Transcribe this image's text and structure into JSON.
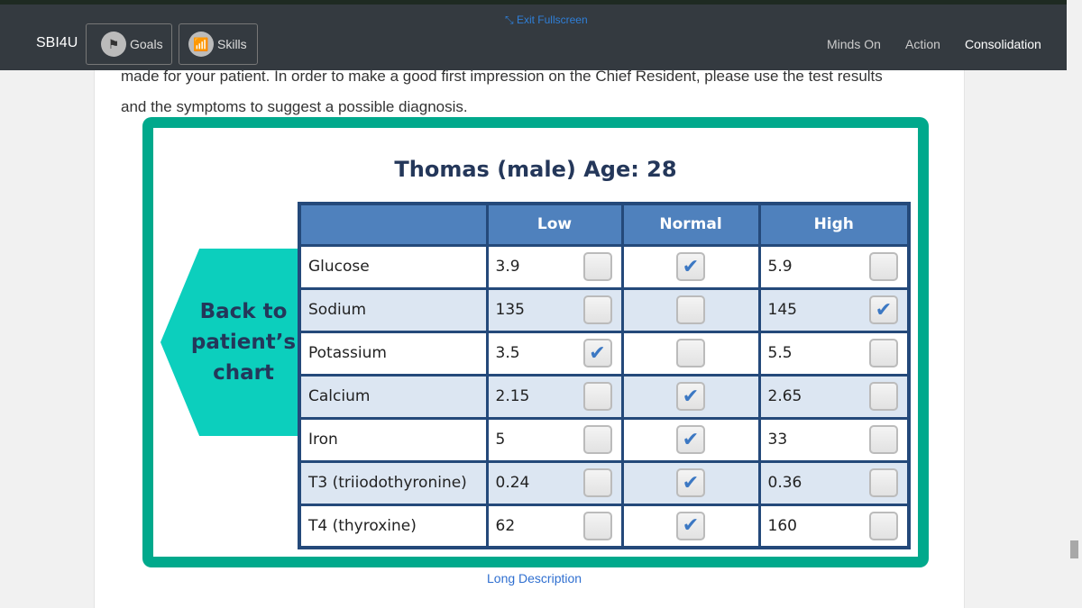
{
  "topbar": {
    "brand": "SBI4U",
    "goals": "Goals",
    "skills": "Skills",
    "exit_fullscreen": "Exit Fullscreen",
    "right_nav": [
      "Minds On",
      "Action",
      "Consolidation"
    ]
  },
  "intro": {
    "line1": "made for your patient. In order to make a good first impression on the Chief Resident, please use the test results",
    "line2": "and the symptoms to suggest a possible diagnosis."
  },
  "panel": {
    "title": "Thomas (male) Age: 28",
    "back_button": "Back to patient’s chart",
    "headers": [
      "",
      "Low",
      "Normal",
      "High"
    ],
    "rows": [
      {
        "name": "Glucose",
        "low": "3.9",
        "high": "5.9",
        "checked": "normal"
      },
      {
        "name": "Sodium",
        "low": "135",
        "high": "145",
        "checked": "high"
      },
      {
        "name": "Potassium",
        "low": "3.5",
        "high": "5.5",
        "checked": "low"
      },
      {
        "name": "Calcium",
        "low": "2.15",
        "high": "2.65",
        "checked": "normal"
      },
      {
        "name": "Iron",
        "low": "5",
        "high": "33",
        "checked": "normal"
      },
      {
        "name": "T3 (triiodothyronine)",
        "low": "0.24",
        "high": "0.36",
        "checked": "normal"
      },
      {
        "name": "T4 (thyroxine)",
        "low": "62",
        "high": "160",
        "checked": "normal"
      }
    ]
  },
  "long_description": "Long Description",
  "colors": {
    "frame": "#00a98c",
    "header": "#4f81bd",
    "button": "#0ccfbd"
  }
}
